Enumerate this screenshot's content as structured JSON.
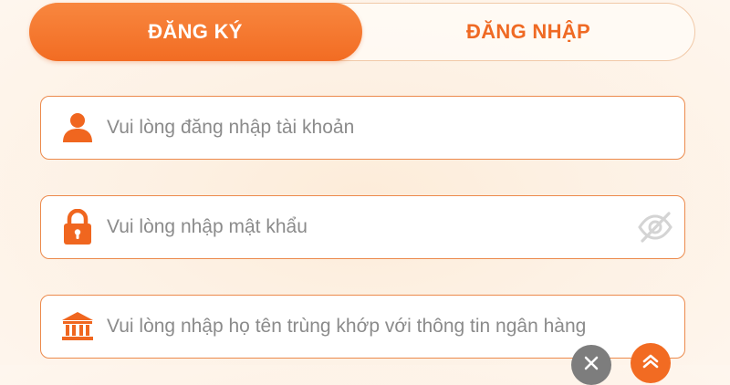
{
  "tabs": {
    "register_label": "ĐĂNG KÝ",
    "login_label": "ĐĂNG NHẬP",
    "active": "register"
  },
  "form": {
    "username": {
      "icon": "user-icon",
      "placeholder": "Vui lòng đăng nhập tài khoản",
      "value": ""
    },
    "password": {
      "icon": "lock-icon",
      "placeholder": "Vui lòng nhập mật khẩu",
      "value": "",
      "toggle_icon": "eye-slash-icon"
    },
    "fullname": {
      "icon": "bank-icon",
      "placeholder": "Vui lòng nhập họ tên trùng khớp với thông tin ngân hàng",
      "value": ""
    }
  },
  "floating": {
    "close_icon": "close-icon",
    "scroll_top_icon": "chevron-up-double-icon"
  },
  "colors": {
    "accent": "#f26c23",
    "field_border": "#ec8a4c",
    "placeholder": "#8b8b8b",
    "background": "#fdf1e4"
  }
}
